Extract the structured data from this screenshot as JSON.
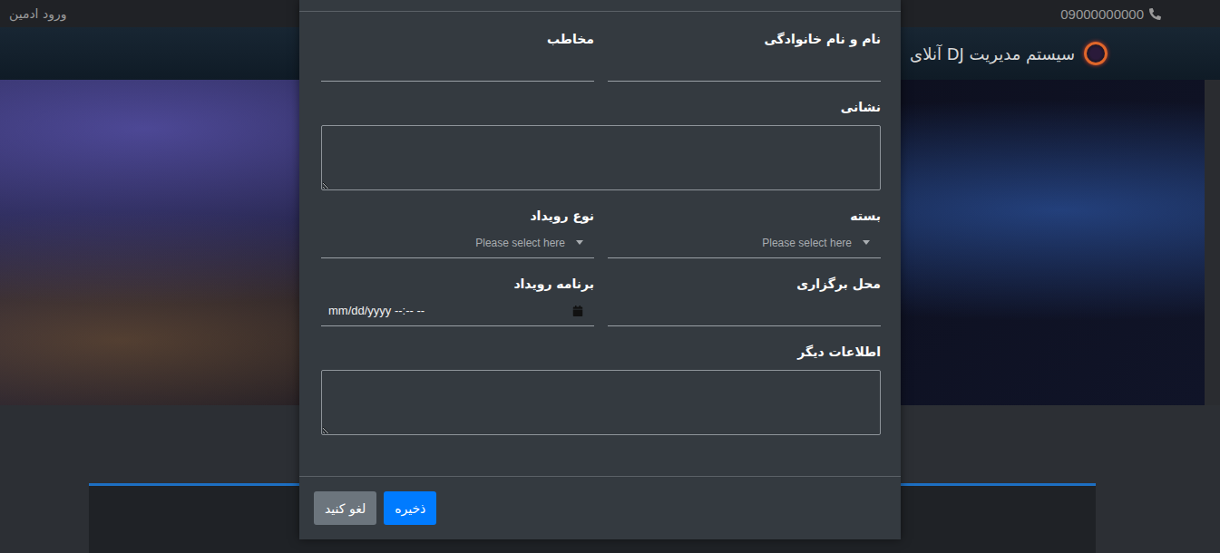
{
  "top_bar": {
    "phone": "09000000000",
    "login": "ورود ادمین"
  },
  "navbar": {
    "brand": "سیستم مدیریت DJ آنلای"
  },
  "modal": {
    "rows": [
      [
        {
          "label": "نام و نام خانوادگی",
          "kind": "text",
          "value": ""
        },
        {
          "label": "مخاطب",
          "kind": "text",
          "value": ""
        }
      ],
      [
        {
          "label": "نشانی",
          "kind": "textarea",
          "value": ""
        }
      ],
      [
        {
          "label": "بسته",
          "kind": "select",
          "value": "Please select here"
        },
        {
          "label": "نوع رویداد",
          "kind": "select",
          "value": "Please select here"
        }
      ],
      [
        {
          "label": "محل برگزاری",
          "kind": "text",
          "value": ""
        },
        {
          "label": "برنامه رویداد",
          "kind": "datetime",
          "value": "mm/dd/yyyy --:-- --"
        }
      ],
      [
        {
          "label": "اطلاعات دیگر",
          "kind": "textarea",
          "value": ""
        }
      ]
    ],
    "buttons": [
      {
        "label": "ذخیره",
        "kind": "primary"
      },
      {
        "label": "لغو کنید",
        "kind": "secondary"
      }
    ]
  }
}
